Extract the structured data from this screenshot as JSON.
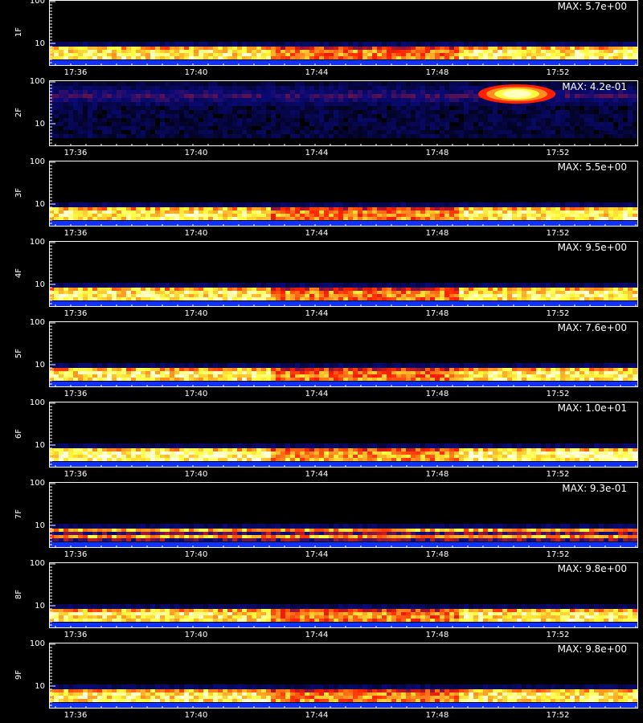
{
  "chart_data": {
    "type": "heatmap",
    "x_ticks": [
      "17:36",
      "17:40",
      "17:44",
      "17:48",
      "17:52"
    ],
    "y_ticks": [
      "100",
      "10"
    ],
    "y_scale": "log",
    "colors": {
      "background": "#000000",
      "low": "#0a0a7a",
      "mid": "#ff2000",
      "high": "#ffff40",
      "peak": "#ffffe0",
      "floor": "#1030ff"
    },
    "panels": [
      {
        "label": "1F",
        "max_text": "MAX: 5.7e+00",
        "band_level": 0.85,
        "floor_band": true
      },
      {
        "label": "2F",
        "max_text": "MAX: 4.2e-01",
        "band_level": 0.15,
        "floor_band": false,
        "hotspot": {
          "time": "17:51",
          "level": 0.95
        }
      },
      {
        "label": "3F",
        "max_text": "MAX: 5.5e+00",
        "band_level": 0.85,
        "floor_band": true
      },
      {
        "label": "4F",
        "max_text": "MAX: 9.5e+00",
        "band_level": 0.85,
        "floor_band": true
      },
      {
        "label": "5F",
        "max_text": "MAX: 7.6e+00",
        "band_level": 0.85,
        "floor_band": true
      },
      {
        "label": "6F",
        "max_text": "MAX: 1.0e+01",
        "band_level": 0.9,
        "floor_band": true
      },
      {
        "label": "7F",
        "max_text": "MAX: 9.3e-01",
        "band_level": 0.7,
        "floor_band": true
      },
      {
        "label": "8F",
        "max_text": "MAX: 9.8e+00",
        "band_level": 0.85,
        "floor_band": true
      },
      {
        "label": "9F",
        "max_text": "MAX: 9.8e+00",
        "band_level": 0.85,
        "floor_band": true
      }
    ]
  }
}
